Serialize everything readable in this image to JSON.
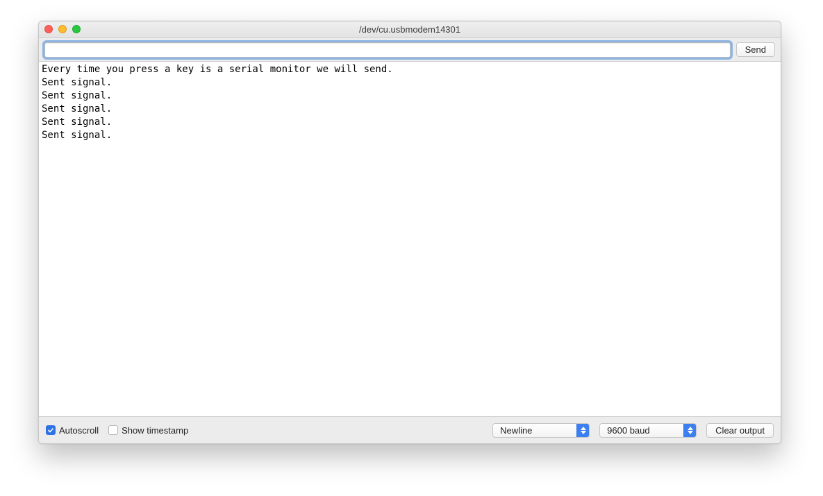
{
  "window": {
    "title": "/dev/cu.usbmodem14301"
  },
  "toolbar": {
    "input_value": "",
    "send_label": "Send"
  },
  "log": {
    "lines": [
      "Every time you press a key is a serial monitor we will send.",
      "Sent signal.",
      "Sent signal.",
      "Sent signal.",
      "Sent signal.",
      "Sent signal."
    ]
  },
  "bottom": {
    "autoscroll_label": "Autoscroll",
    "autoscroll_checked": true,
    "timestamp_label": "Show timestamp",
    "timestamp_checked": false,
    "line_ending_selected": "Newline",
    "baud_selected": "9600 baud",
    "clear_label": "Clear output"
  }
}
